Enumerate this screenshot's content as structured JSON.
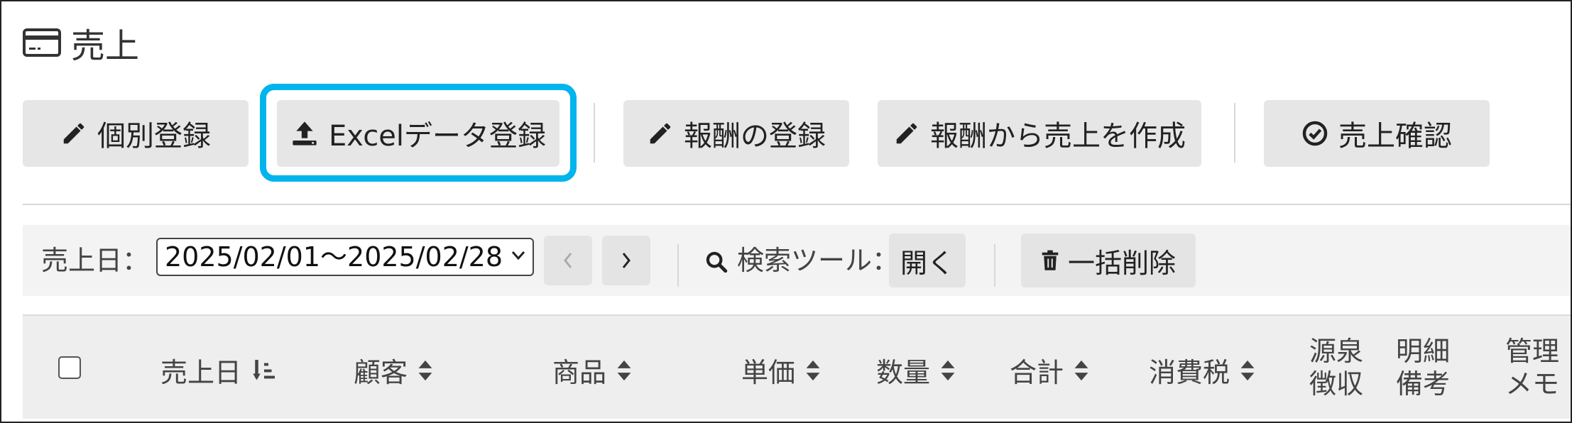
{
  "header": {
    "title": "売上",
    "icon": "credit-card-icon"
  },
  "toolbar": {
    "individual": "個別登録",
    "excel": "Excelデータ登録",
    "reward_register": "報酬の登録",
    "reward_to_sales": "報酬から売上を作成",
    "confirm": "売上確認"
  },
  "filter": {
    "date_label": "売上日：",
    "date_range": "2025/02/01～2025/02/28",
    "search_tool_label": "検索ツール：",
    "open": "開く",
    "bulk_delete": "一括削除"
  },
  "table": {
    "columns": {
      "sales_date": "売上日",
      "customer": "顧客",
      "product": "商品",
      "unit_price": "単価",
      "quantity": "数量",
      "total": "合計",
      "consumption_tax": "消費税",
      "withholding_1": "源泉",
      "withholding_2": "徴収",
      "detail_1": "明細",
      "detail_2": "備考",
      "memo_1": "管理",
      "memo_2": "メモ"
    }
  },
  "colors": {
    "highlight": "#00b4ee",
    "button_bg": "#e6e6e6"
  }
}
